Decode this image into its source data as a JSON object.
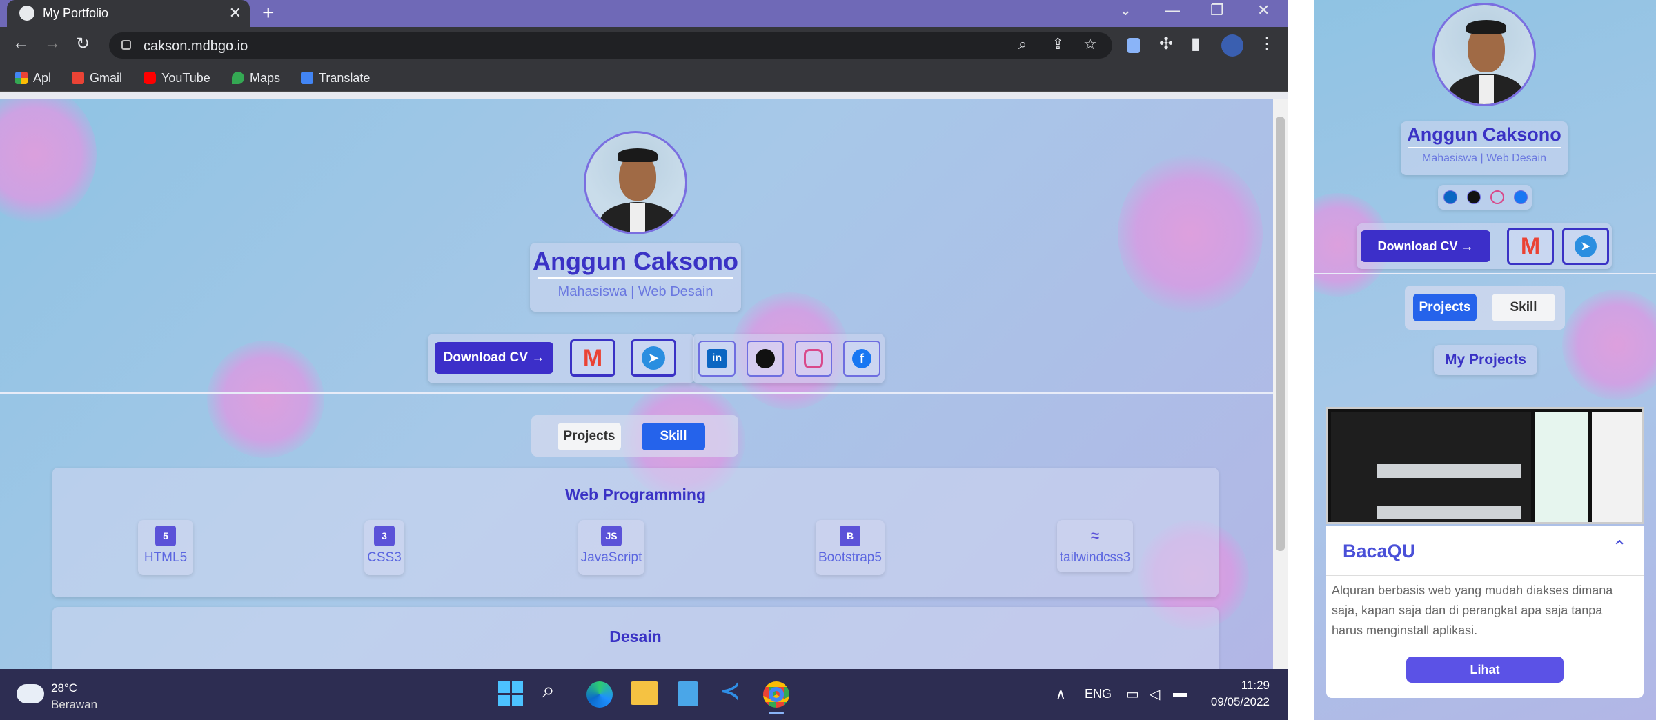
{
  "browser": {
    "tab_title": "My Portfolio",
    "url": "cakson.mdbgo.io",
    "bookmarks": [
      {
        "label": "Apl",
        "icon": "apps-grid-icon"
      },
      {
        "label": "Gmail",
        "icon": "gmail-icon"
      },
      {
        "label": "YouTube",
        "icon": "youtube-icon"
      },
      {
        "label": "Maps",
        "icon": "maps-icon"
      },
      {
        "label": "Translate",
        "icon": "translate-icon"
      }
    ]
  },
  "profile": {
    "name": "Anggun Caksono",
    "subtitle": "Mahasiswa | Web Desain",
    "download_label": "Download CV →"
  },
  "tabs": {
    "projects": "Projects",
    "skill": "Skill",
    "active": "Skill"
  },
  "skills": {
    "web_title": "Web Programming",
    "items": [
      {
        "label": "HTML5",
        "icon": "html5-icon"
      },
      {
        "label": "CSS3",
        "icon": "css3-icon"
      },
      {
        "label": "JavaScript",
        "icon": "javascript-icon"
      },
      {
        "label": "Bootstrap5",
        "icon": "bootstrap-icon"
      },
      {
        "label": "tailwindcss3",
        "icon": "tailwind-icon"
      }
    ],
    "design_title": "Desain"
  },
  "taskbar": {
    "temp": "28°C",
    "weather": "Berawan",
    "lang": "ENG",
    "time": "11:29",
    "date": "09/05/2022"
  },
  "mobile": {
    "name": "Anggun Caksono",
    "subtitle": "Mahasiswa | Web Desain",
    "download_label": "Download CV →",
    "tabs": {
      "projects": "Projects",
      "skill": "Skill",
      "active": "Projects"
    },
    "section_title": "My Projects",
    "project": {
      "title": "BacaQU",
      "description": "Alquran berbasis web yang mudah diakses dimana saja, kapan saja dan di perangkat apa saja tanpa harus menginstall aplikasi.",
      "button": "Lihat"
    }
  },
  "colors": {
    "accent": "#3c2fc9",
    "active_tab": "#2563eb",
    "title": "#3a32c5"
  }
}
